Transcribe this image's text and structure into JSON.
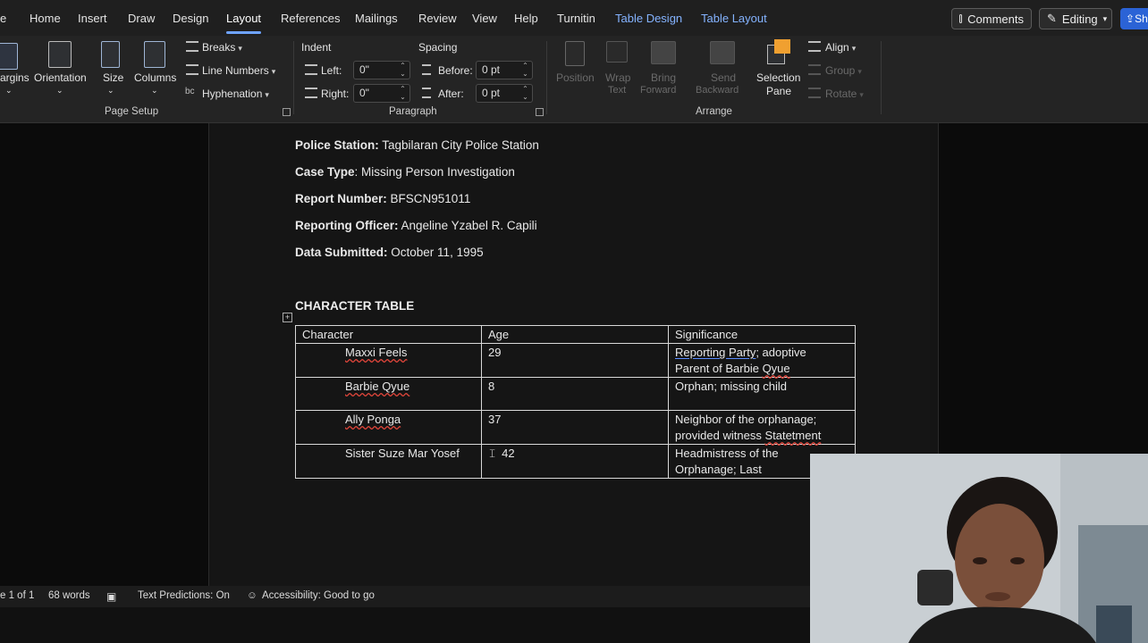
{
  "tabs": {
    "file_partial": "e",
    "home": "Home",
    "insert": "Insert",
    "draw": "Draw",
    "design": "Design",
    "layout": "Layout",
    "references": "References",
    "mailings": "Mailings",
    "review": "Review",
    "view": "View",
    "help": "Help",
    "turnitin": "Turnitin",
    "table_design": "Table Design",
    "table_layout": "Table Layout"
  },
  "top_buttons": {
    "comments": "Comments",
    "editing": "Editing",
    "share_partial": "Sh"
  },
  "ribbon": {
    "page_setup": {
      "margins_partial": "argins",
      "orientation": "Orientation",
      "size": "Size",
      "columns": "Columns",
      "breaks": "Breaks",
      "line_numbers": "Line Numbers",
      "hyphenation": "Hyphenation",
      "title": "Page Setup"
    },
    "paragraph": {
      "indent_header": "Indent",
      "spacing_header": "Spacing",
      "left_label": "Left:",
      "left_value": "0\"",
      "right_label": "Right:",
      "right_value": "0\"",
      "before_label": "Before:",
      "before_value": "0 pt",
      "after_label": "After:",
      "after_value": "0 pt",
      "title": "Paragraph"
    },
    "arrange": {
      "position": "Position",
      "wrap_text_1": "Wrap",
      "wrap_text_2": "Text",
      "bring_forward_1": "Bring",
      "bring_forward_2": "Forward",
      "send_backward_1": "Send",
      "send_backward_2": "Backward",
      "selection_pane_1": "Selection",
      "selection_pane_2": "Pane",
      "align": "Align",
      "group": "Group",
      "rotate": "Rotate",
      "title": "Arrange"
    }
  },
  "document": {
    "police_station_label": "Police Station:",
    "police_station_value": "Tagbilaran City Police Station",
    "case_type_label": "Case Type",
    "case_type_value": ": Missing Person Investigation",
    "report_number_label": "Report Number:",
    "report_number_value": "BFSCN951011",
    "reporting_officer_label": "Reporting Officer:",
    "reporting_officer_value": "Angeline Yzabel R. Capili",
    "data_submitted_label": "Data Submitted:",
    "data_submitted_value": "October 11, 1995",
    "section_heading": "CHARACTER TABLE",
    "table": {
      "headers": [
        "Character",
        "Age",
        "Significance"
      ],
      "rows": [
        {
          "name": "Maxxi Feels",
          "age": "29",
          "sig_1": "Reporting Party",
          "sig_2": "; adoptive",
          "sig_3": "Parent of Barbie ",
          "sig_4": "Qyue"
        },
        {
          "name": "Barbie Qyue",
          "age": "8",
          "sig_1": "Orphan; missing child"
        },
        {
          "name": "Ally Ponga",
          "age": "37",
          "sig_1": "Neighbor of the orphanage;",
          "sig_2": "provided witness ",
          "sig_3": "Statetment"
        },
        {
          "name": "Sister Suze Mar Yosef",
          "age": "42",
          "sig_1": "Headmistress of the",
          "sig_2": "Orphanage; Last"
        }
      ]
    }
  },
  "status": {
    "page": "e 1 of 1",
    "words": "68 words",
    "text_predictions": "Text Predictions: On",
    "accessibility": "Accessibility: Good to go"
  },
  "colors": {
    "accent_blue": "#6ea3ff",
    "context_tab": "#84b3ff",
    "spell_error": "#e0453a",
    "grammar_mark": "#5a8cff"
  }
}
